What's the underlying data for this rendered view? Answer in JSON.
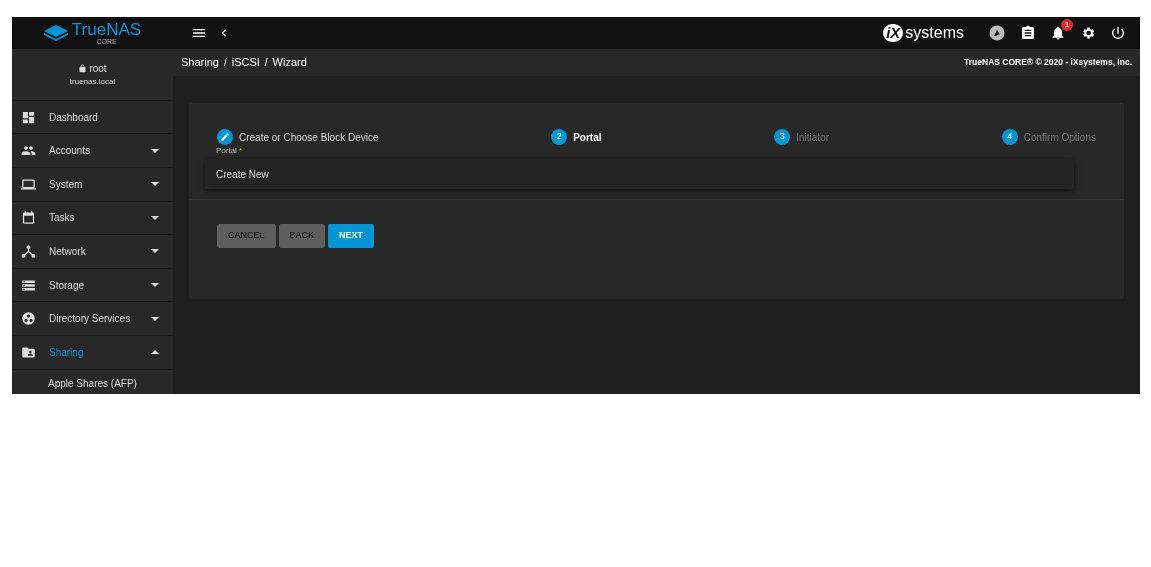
{
  "header": {
    "logo": "TrueNAS",
    "logo_sub": "CORE",
    "vendor": "systems",
    "vendor_mark": "iX",
    "notifications": "1"
  },
  "user": {
    "name": "root",
    "host": "truenas.local"
  },
  "sidebar": {
    "items": [
      {
        "label": "Dashboard",
        "expandable": false,
        "expanded": false,
        "selected": false
      },
      {
        "label": "Accounts",
        "expandable": true,
        "expanded": false,
        "selected": false
      },
      {
        "label": "System",
        "expandable": true,
        "expanded": false,
        "selected": false
      },
      {
        "label": "Tasks",
        "expandable": true,
        "expanded": false,
        "selected": false
      },
      {
        "label": "Network",
        "expandable": true,
        "expanded": false,
        "selected": false
      },
      {
        "label": "Storage",
        "expandable": true,
        "expanded": false,
        "selected": false
      },
      {
        "label": "Directory Services",
        "expandable": true,
        "expanded": false,
        "selected": false
      },
      {
        "label": "Sharing",
        "expandable": true,
        "expanded": true,
        "selected": true,
        "children": [
          {
            "label": "Apple Shares (AFP)"
          }
        ]
      }
    ]
  },
  "breadcrumb": [
    {
      "label": "Sharing"
    },
    {
      "separator": "/",
      "label": "iSCSI"
    },
    {
      "separator": "/",
      "label": "Wizard"
    }
  ],
  "copyright": "TrueNAS CORE® © 2020 - iXsystems, Inc.",
  "steps": [
    {
      "label": "Create or Choose Block Device",
      "completed": true,
      "selected": false,
      "disabled": false
    },
    {
      "number": "2",
      "label": "Portal",
      "completed": false,
      "selected": true,
      "disabled": false
    },
    {
      "number": "3",
      "label": "Initiator",
      "completed": false,
      "selected": false,
      "disabled": true
    },
    {
      "number": "4",
      "label": "Confirm Options",
      "completed": false,
      "selected": false,
      "disabled": true
    }
  ],
  "portal_field": {
    "label": "Portal",
    "required_mark": "*",
    "options": [
      "Create New"
    ]
  },
  "buttons": [
    {
      "label": "CANCEL",
      "kind": "secondary"
    },
    {
      "label": "BACK",
      "kind": "secondary"
    },
    {
      "label": "NEXT",
      "kind": "primary"
    }
  ]
}
